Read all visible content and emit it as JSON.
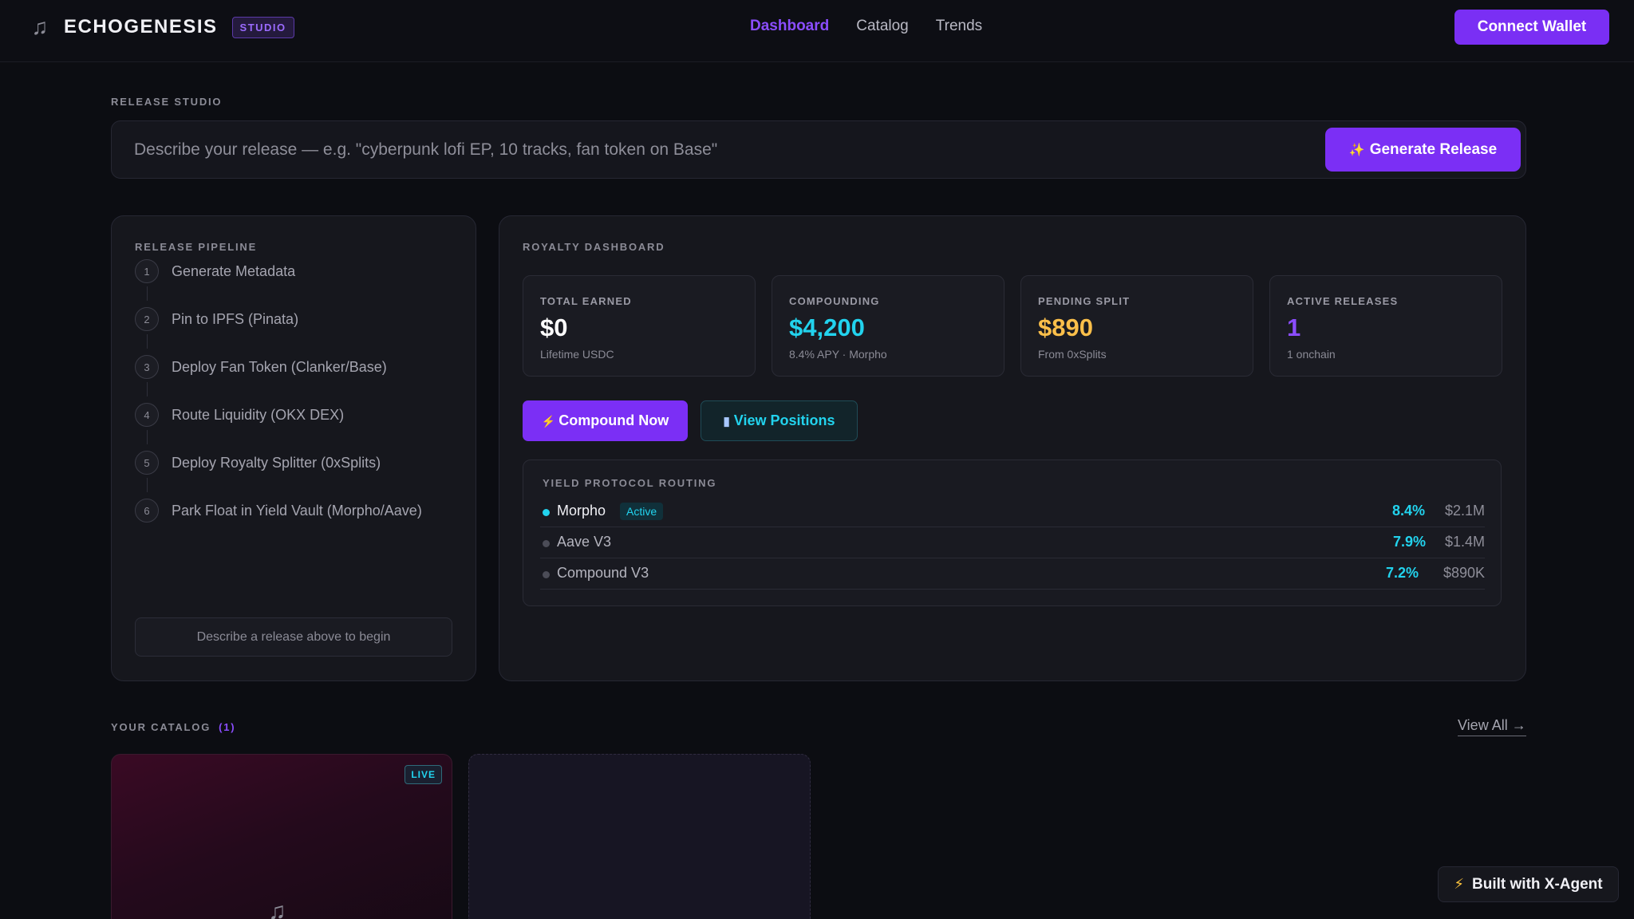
{
  "nav": {
    "brand_name": "ECHOGENESIS",
    "badge": "STUDIO",
    "links": [
      "Dashboard",
      "Catalog",
      "Trends"
    ],
    "connect_label": "Connect Wallet"
  },
  "studio": {
    "label": "RELEASE STUDIO",
    "placeholder": "Describe your release — e.g. \"cyberpunk lofi EP, 10 tracks, fan token on Base\"",
    "generate_label": "Generate Release"
  },
  "pipeline": {
    "label": "RELEASE PIPELINE",
    "steps": [
      {
        "num": "1",
        "label": "Generate Metadata"
      },
      {
        "num": "2",
        "label": "Pin to IPFS (Pinata)"
      },
      {
        "num": "3",
        "label": "Deploy Fan Token (Clanker/Base)"
      },
      {
        "num": "4",
        "label": "Route Liquidity (OKX DEX)"
      },
      {
        "num": "5",
        "label": "Deploy Royalty Splitter (0xSplits)"
      },
      {
        "num": "6",
        "label": "Park Float in Yield Vault (Morpho/Aave)"
      }
    ],
    "hint": "Describe a release above to begin"
  },
  "royalty": {
    "label": "ROYALTY DASHBOARD",
    "stats": [
      {
        "label": "TOTAL EARNED",
        "value": "$0",
        "sub": "Lifetime USDC",
        "color": "#ffffff"
      },
      {
        "label": "COMPOUNDING",
        "value": "$4,200",
        "sub": "8.4% APY · Morpho",
        "color": "#22d3ee"
      },
      {
        "label": "PENDING SPLIT",
        "value": "$890",
        "sub": "From 0xSplits",
        "color": "#fbbf4a"
      },
      {
        "label": "ACTIVE RELEASES",
        "value": "1",
        "sub": "1 onchain",
        "color": "#8b4dff"
      }
    ],
    "compound_label": "Compound Now",
    "positions_label": "View Positions",
    "yield_label": "YIELD PROTOCOL ROUTING",
    "protocols": [
      {
        "name": "Morpho",
        "status": "Active",
        "apy": "8.4%",
        "tvl": "$2.1M",
        "active": true
      },
      {
        "name": "Aave V3",
        "apy": "7.9%",
        "tvl": "$1.4M",
        "active": false
      },
      {
        "name": "Compound V3",
        "apy": "7.2%",
        "tvl": "$890K",
        "active": false
      }
    ]
  },
  "catalog": {
    "label": "YOUR CATALOG",
    "count": "(1)",
    "view_all": "View All →",
    "live_badge": "LIVE"
  },
  "agent_badge": "Built with X-Agent",
  "colors": {
    "accent": "#7b2ff5",
    "cyan": "#22d3ee",
    "amber": "#fbbf4a",
    "background": "#0c0d12"
  }
}
